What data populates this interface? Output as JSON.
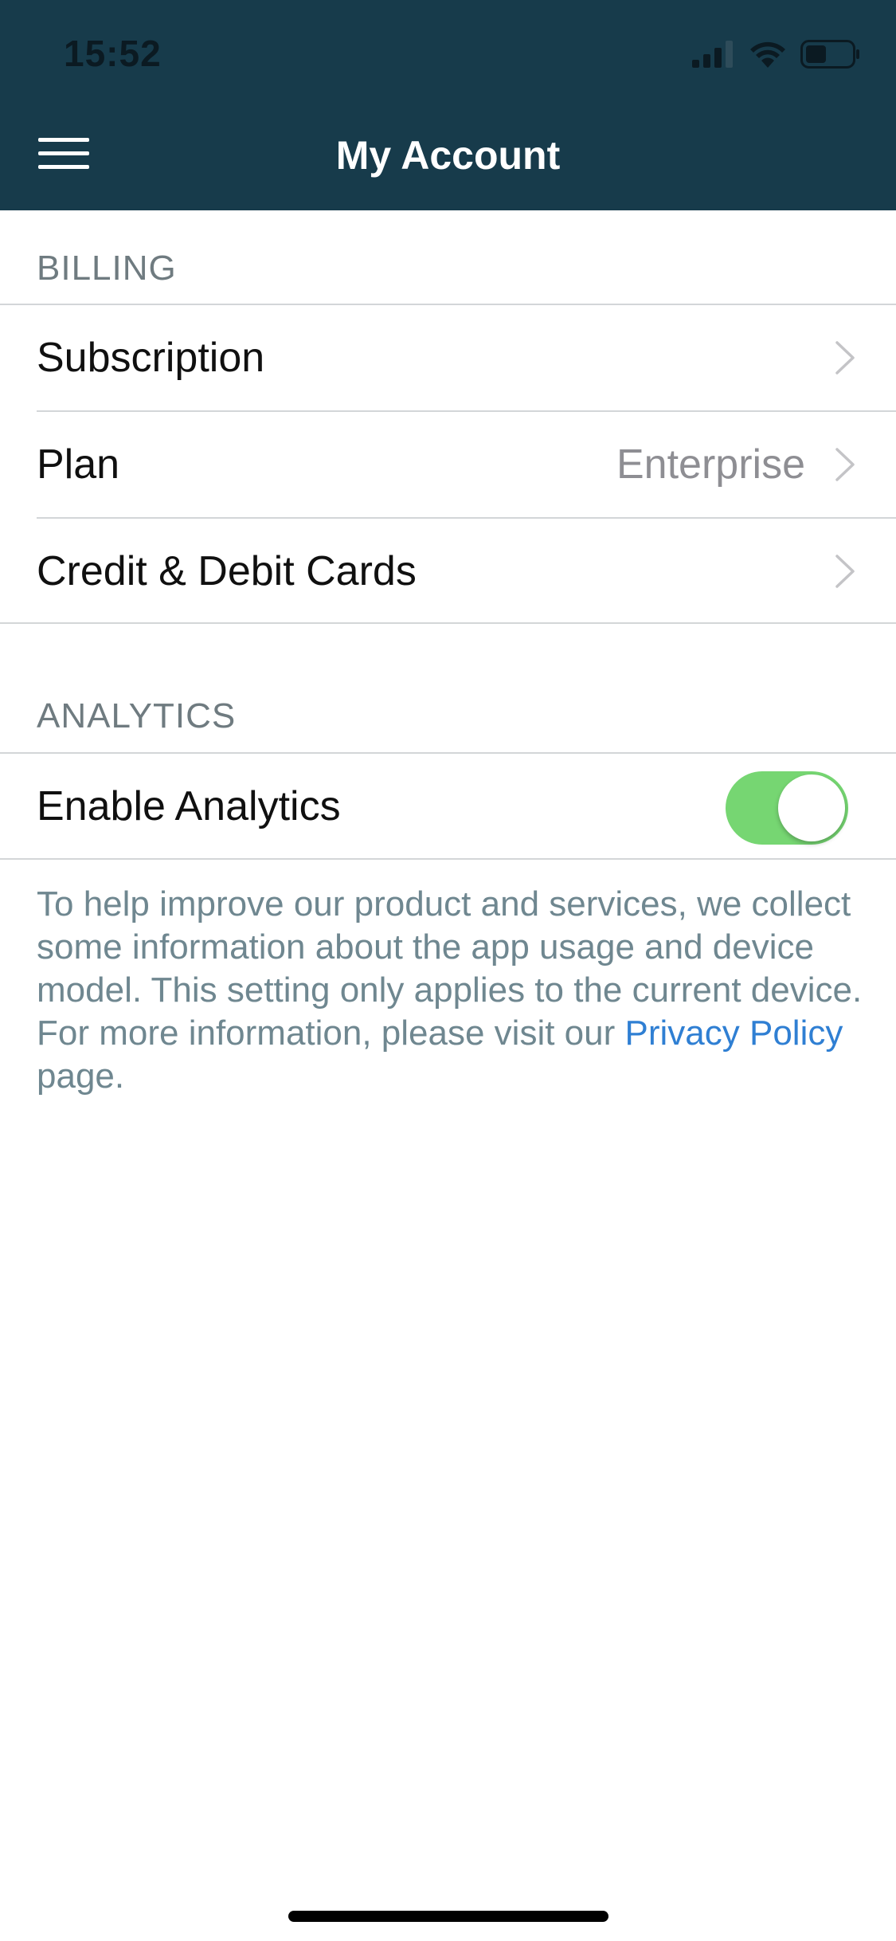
{
  "status_bar": {
    "time": "15:52"
  },
  "nav": {
    "title": "My Account",
    "menu_icon": "hamburger-menu-icon"
  },
  "billing": {
    "header": "BILLING",
    "items": [
      {
        "label": "Subscription",
        "value": ""
      },
      {
        "label": "Plan",
        "value": "Enterprise"
      },
      {
        "label": "Credit & Debit Cards",
        "value": ""
      }
    ]
  },
  "analytics": {
    "header": "ANALYTICS",
    "toggle_label": "Enable Analytics",
    "toggle_on": true,
    "description": "To help improve our product and services, we collect some information about the app usage and device model. This setting only applies to the current device.",
    "more_info_prefix": "For more information, please visit our ",
    "link_text": "Privacy Policy",
    "more_info_suffix": " page."
  },
  "colors": {
    "header_bg": "#173b4b",
    "toggle_on": "#76d672",
    "link": "#2f7fd3",
    "section_header_text": "#6f7b80",
    "info_text": "#6f8790"
  }
}
